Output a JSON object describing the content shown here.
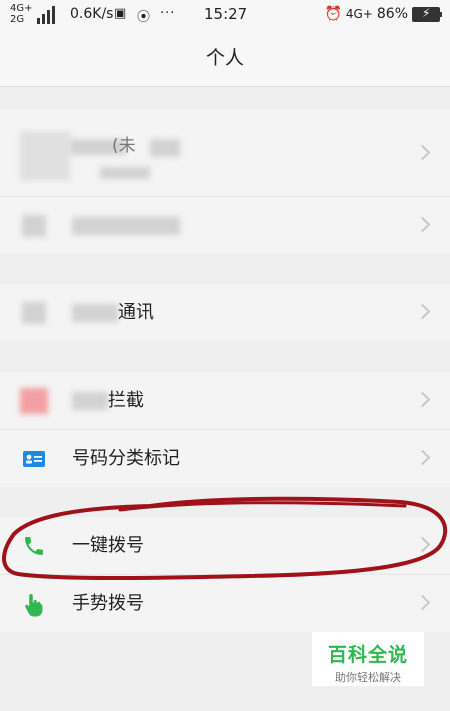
{
  "status_bar": {
    "network_top": "4G+",
    "network_bottom": "2G",
    "speed": "0.6K/s",
    "time": "15:27",
    "right_network": "4G+",
    "battery_percent": "86%"
  },
  "header": {
    "title": "个人"
  },
  "rows": {
    "profile_hint": "(未",
    "comm_suffix": "通讯",
    "block_suffix": "拦截",
    "number_mark": "号码分类标记",
    "one_key_dial": "一键拨号",
    "gesture_dial": "手势拨号"
  },
  "watermark": {
    "title": "百科全说",
    "subtitle": "助你轻松解决"
  },
  "colors": {
    "accent_green": "#2eb84f",
    "annotation_red": "#a0121a",
    "card_blue": "#1e88e5"
  }
}
